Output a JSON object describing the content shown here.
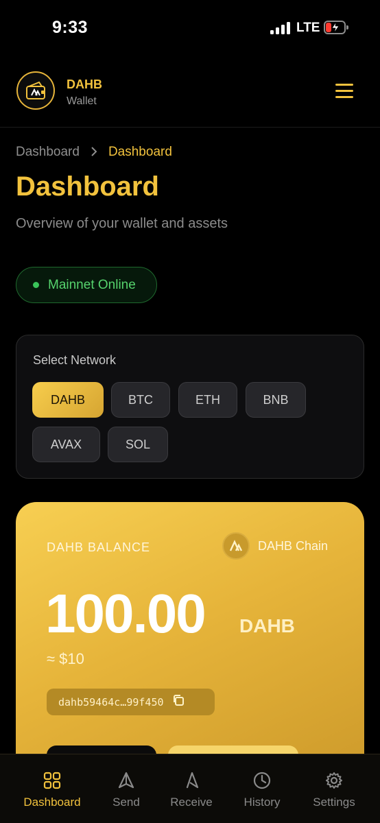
{
  "status_bar": {
    "time": "9:33",
    "network": "LTE"
  },
  "header": {
    "brand": "DAHB",
    "subtitle": "Wallet",
    "logo_icon": "wallet-logo-icon",
    "menu_icon": "hamburger-menu-icon"
  },
  "breadcrumb": {
    "root": "Dashboard",
    "separator": ">",
    "current": "Dashboard"
  },
  "page": {
    "title": "Dashboard",
    "subtitle": "Overview of your wallet and assets"
  },
  "network_status": {
    "label": "Mainnet Online",
    "color": "#3ac35a"
  },
  "network_select": {
    "heading": "Select Network",
    "selected": "DAHB",
    "options": [
      "DAHB",
      "BTC",
      "ETH",
      "BNB",
      "AVAX",
      "SOL"
    ]
  },
  "balance": {
    "label": "DAHB BALANCE",
    "chain": "DAHB Chain",
    "amount": "100.00",
    "unit": "DAHB",
    "usd": "≈ $10",
    "address": "dahb59464c…99f450",
    "copy_icon": "copy-icon"
  },
  "bottom_nav": {
    "active": "Dashboard",
    "items": [
      {
        "label": "Dashboard",
        "icon": "grid-icon"
      },
      {
        "label": "Send",
        "icon": "send-icon"
      },
      {
        "label": "Receive",
        "icon": "receive-icon"
      },
      {
        "label": "History",
        "icon": "clock-icon"
      },
      {
        "label": "Settings",
        "icon": "gear-icon"
      }
    ]
  },
  "colors": {
    "accent": "#f2c23d",
    "background": "#000000",
    "online": "#3ac35a"
  }
}
